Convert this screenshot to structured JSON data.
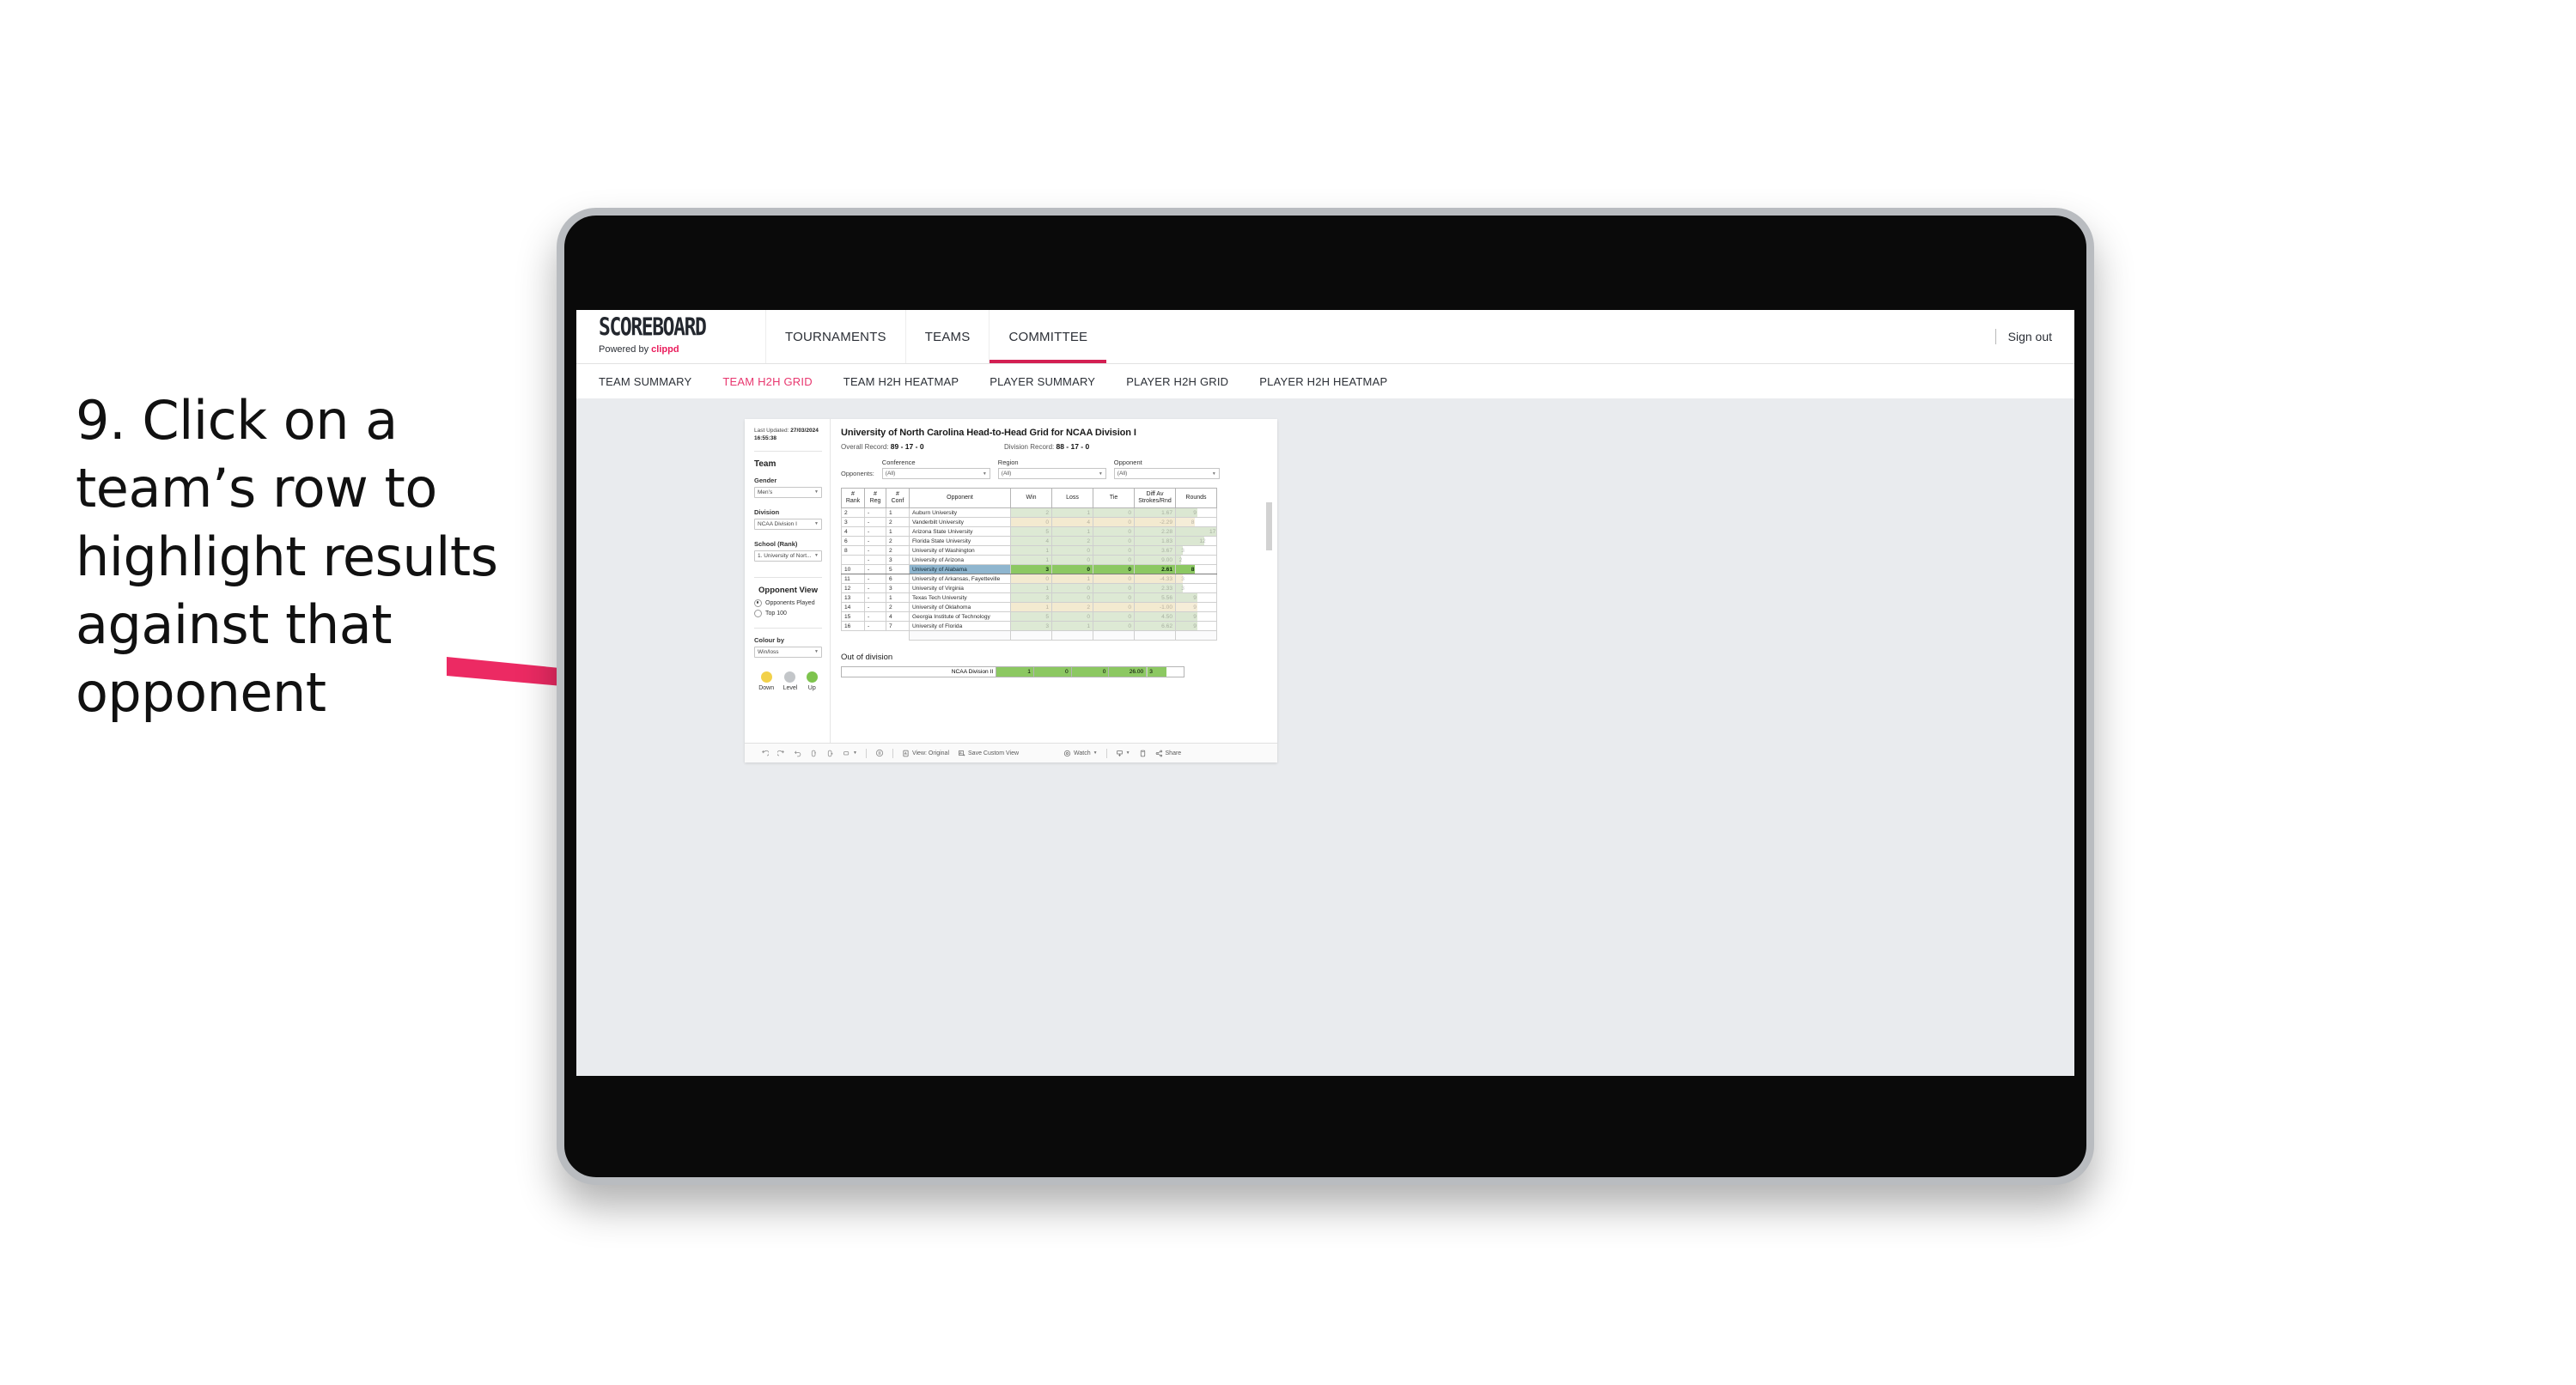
{
  "instruction": {
    "text": "9. Click on a team’s row to highlight results against that opponent"
  },
  "app": {
    "brand_name": "SCOREBOARD",
    "brand_powered_prefix": "Powered by ",
    "brand_powered_name": "clippd",
    "nav_tabs": [
      {
        "label": "TOURNAMENTS",
        "active": false
      },
      {
        "label": "TEAMS",
        "active": false
      },
      {
        "label": "COMMITTEE",
        "active": true
      }
    ],
    "sign_out": "Sign out",
    "sub_tabs": [
      {
        "label": "TEAM SUMMARY",
        "active": false
      },
      {
        "label": "TEAM H2H GRID",
        "active": true
      },
      {
        "label": "TEAM H2H HEATMAP",
        "active": false
      },
      {
        "label": "PLAYER SUMMARY",
        "active": false
      },
      {
        "label": "PLAYER H2H GRID",
        "active": false
      },
      {
        "label": "PLAYER H2H HEATMAP",
        "active": false
      }
    ]
  },
  "sidebar": {
    "last_updated_label": "Last Updated: ",
    "last_updated_value": "27/03/2024 16:55:38",
    "team_heading": "Team",
    "gender_label": "Gender",
    "gender_value": "Men’s",
    "division_label": "Division",
    "division_value": "NCAA Division I",
    "school_label": "School (Rank)",
    "school_value": "1. University of Nort...",
    "opponent_view_heading": "Opponent View",
    "opponent_view_options": [
      {
        "label": "Opponents Played",
        "selected": true
      },
      {
        "label": "Top 100",
        "selected": false
      }
    ],
    "colour_by_label": "Colour by",
    "colour_by_value": "Win/loss",
    "legend": [
      {
        "label": "Down",
        "color": "#f2d14a"
      },
      {
        "label": "Level",
        "color": "#c3c6c9"
      },
      {
        "label": "Up",
        "color": "#7ec44e"
      }
    ]
  },
  "viz": {
    "title": "University of North Carolina Head-to-Head Grid for NCAA Division I",
    "overall_record_label": "Overall Record: ",
    "overall_record_value": "89 - 17 - 0",
    "division_record_label": "Division Record: ",
    "division_record_value": "88 - 17 - 0",
    "opponents_lead": "Opponents:",
    "filters": [
      {
        "label": "Conference",
        "value": "(All)"
      },
      {
        "label": "Region",
        "value": "(All)"
      },
      {
        "label": "Opponent",
        "value": "(All)"
      }
    ],
    "columns": [
      {
        "label": "#\nRank",
        "line1": "#",
        "line2": "Rank"
      },
      {
        "label": "#\nReg",
        "line1": "#",
        "line2": "Reg"
      },
      {
        "label": "#\nConf",
        "line1": "#",
        "line2": "Conf"
      },
      {
        "label": "Opponent",
        "line1": "Opponent",
        "line2": ""
      },
      {
        "label": "Win",
        "line1": "Win",
        "line2": ""
      },
      {
        "label": "Loss",
        "line1": "Loss",
        "line2": ""
      },
      {
        "label": "Tie",
        "line1": "Tie",
        "line2": ""
      },
      {
        "label": "Diff Av Strokes/Rnd",
        "line1": "Diff Av",
        "line2": "Strokes/Rnd"
      },
      {
        "label": "Rounds",
        "line1": "Rounds",
        "line2": ""
      }
    ],
    "rows": [
      {
        "rank": "2",
        "reg": "-",
        "conf": "1",
        "opponent": "Auburn University",
        "win": "2",
        "loss": "1",
        "tie": "0",
        "diff": "1.67",
        "rounds": "9",
        "result": "up",
        "selected": false,
        "bar_pct": 53
      },
      {
        "rank": "3",
        "reg": "-",
        "conf": "2",
        "opponent": "Vanderbilt University",
        "win": "0",
        "loss": "4",
        "tie": "0",
        "diff": "-2.29",
        "rounds": "8",
        "result": "down",
        "selected": false,
        "bar_pct": 47
      },
      {
        "rank": "4",
        "reg": "-",
        "conf": "1",
        "opponent": "Arizona State University",
        "win": "5",
        "loss": "1",
        "tie": "0",
        "diff": "2.28",
        "rounds": "17",
        "result": "up",
        "selected": false,
        "bar_pct": 100
      },
      {
        "rank": "6",
        "reg": "-",
        "conf": "2",
        "opponent": "Florida State University",
        "win": "4",
        "loss": "2",
        "tie": "0",
        "diff": "1.83",
        "rounds": "12",
        "result": "up",
        "selected": false,
        "bar_pct": 71
      },
      {
        "rank": "8",
        "reg": "-",
        "conf": "2",
        "opponent": "University of Washington",
        "win": "1",
        "loss": "0",
        "tie": "0",
        "diff": "3.67",
        "rounds": "3",
        "result": "up",
        "selected": false,
        "bar_pct": 18
      },
      {
        "rank": "",
        "reg": "-",
        "conf": "3",
        "opponent": "University of Arizona",
        "win": "1",
        "loss": "0",
        "tie": "0",
        "diff": "9.00",
        "rounds": "2",
        "result": "up",
        "selected": false,
        "bar_pct": 12
      },
      {
        "rank": "10",
        "reg": "-",
        "conf": "5",
        "opponent": "University of Alabama",
        "win": "3",
        "loss": "0",
        "tie": "0",
        "diff": "2.61",
        "rounds": "8",
        "result": "up",
        "selected": true,
        "bar_pct": 47
      },
      {
        "rank": "11",
        "reg": "-",
        "conf": "6",
        "opponent": "University of Arkansas, Fayetteville",
        "win": "0",
        "loss": "1",
        "tie": "0",
        "diff": "-4.33",
        "rounds": "3",
        "result": "down",
        "selected": false,
        "bar_pct": 18
      },
      {
        "rank": "12",
        "reg": "-",
        "conf": "3",
        "opponent": "University of Virginia",
        "win": "1",
        "loss": "0",
        "tie": "0",
        "diff": "2.33",
        "rounds": "3",
        "result": "up",
        "selected": false,
        "bar_pct": 18
      },
      {
        "rank": "13",
        "reg": "-",
        "conf": "1",
        "opponent": "Texas Tech University",
        "win": "3",
        "loss": "0",
        "tie": "0",
        "diff": "5.56",
        "rounds": "9",
        "result": "up",
        "selected": false,
        "bar_pct": 53
      },
      {
        "rank": "14",
        "reg": "-",
        "conf": "2",
        "opponent": "University of Oklahoma",
        "win": "1",
        "loss": "2",
        "tie": "0",
        "diff": "-1.00",
        "rounds": "9",
        "result": "down",
        "selected": false,
        "bar_pct": 53
      },
      {
        "rank": "15",
        "reg": "-",
        "conf": "4",
        "opponent": "Georgia Institute of Technology",
        "win": "5",
        "loss": "0",
        "tie": "0",
        "diff": "4.50",
        "rounds": "9",
        "result": "up",
        "selected": false,
        "bar_pct": 53
      },
      {
        "rank": "16",
        "reg": "-",
        "conf": "7",
        "opponent": "University of Florida",
        "win": "3",
        "loss": "1",
        "tie": "0",
        "diff": "6.62",
        "rounds": "9",
        "result": "up",
        "selected": false,
        "bar_pct": 53
      }
    ],
    "out_of_division_title": "Out of division",
    "out_of_division_row": {
      "label": "NCAA Division II",
      "win": "1",
      "loss": "0",
      "tie": "0",
      "diff": "26.00",
      "rounds": "3"
    }
  },
  "toolbar": {
    "items": [
      {
        "name": "undo-icon",
        "label": ""
      },
      {
        "name": "redo-icon",
        "label": ""
      },
      {
        "name": "revert-icon",
        "label": ""
      },
      {
        "name": "refresh-icon",
        "label": ""
      },
      {
        "name": "pause-icon",
        "label": ""
      },
      {
        "name": "shape-icon",
        "label": ""
      }
    ],
    "view_original": "View: Original",
    "save_custom_view": "Save Custom View",
    "watch": "Watch",
    "share": "Share"
  },
  "colors": {
    "accent_pink": "#e8376f",
    "brand_red": "#d31f52",
    "selected_row_green": "#8cc862",
    "selected_opponent_blue": "#8fb6cf",
    "win_green": "#dde9d4",
    "loss_tan": "#f3ead0",
    "rounds_bar_green": "#dbe7d2",
    "rounds_bar_tan": "#f5edd8"
  }
}
